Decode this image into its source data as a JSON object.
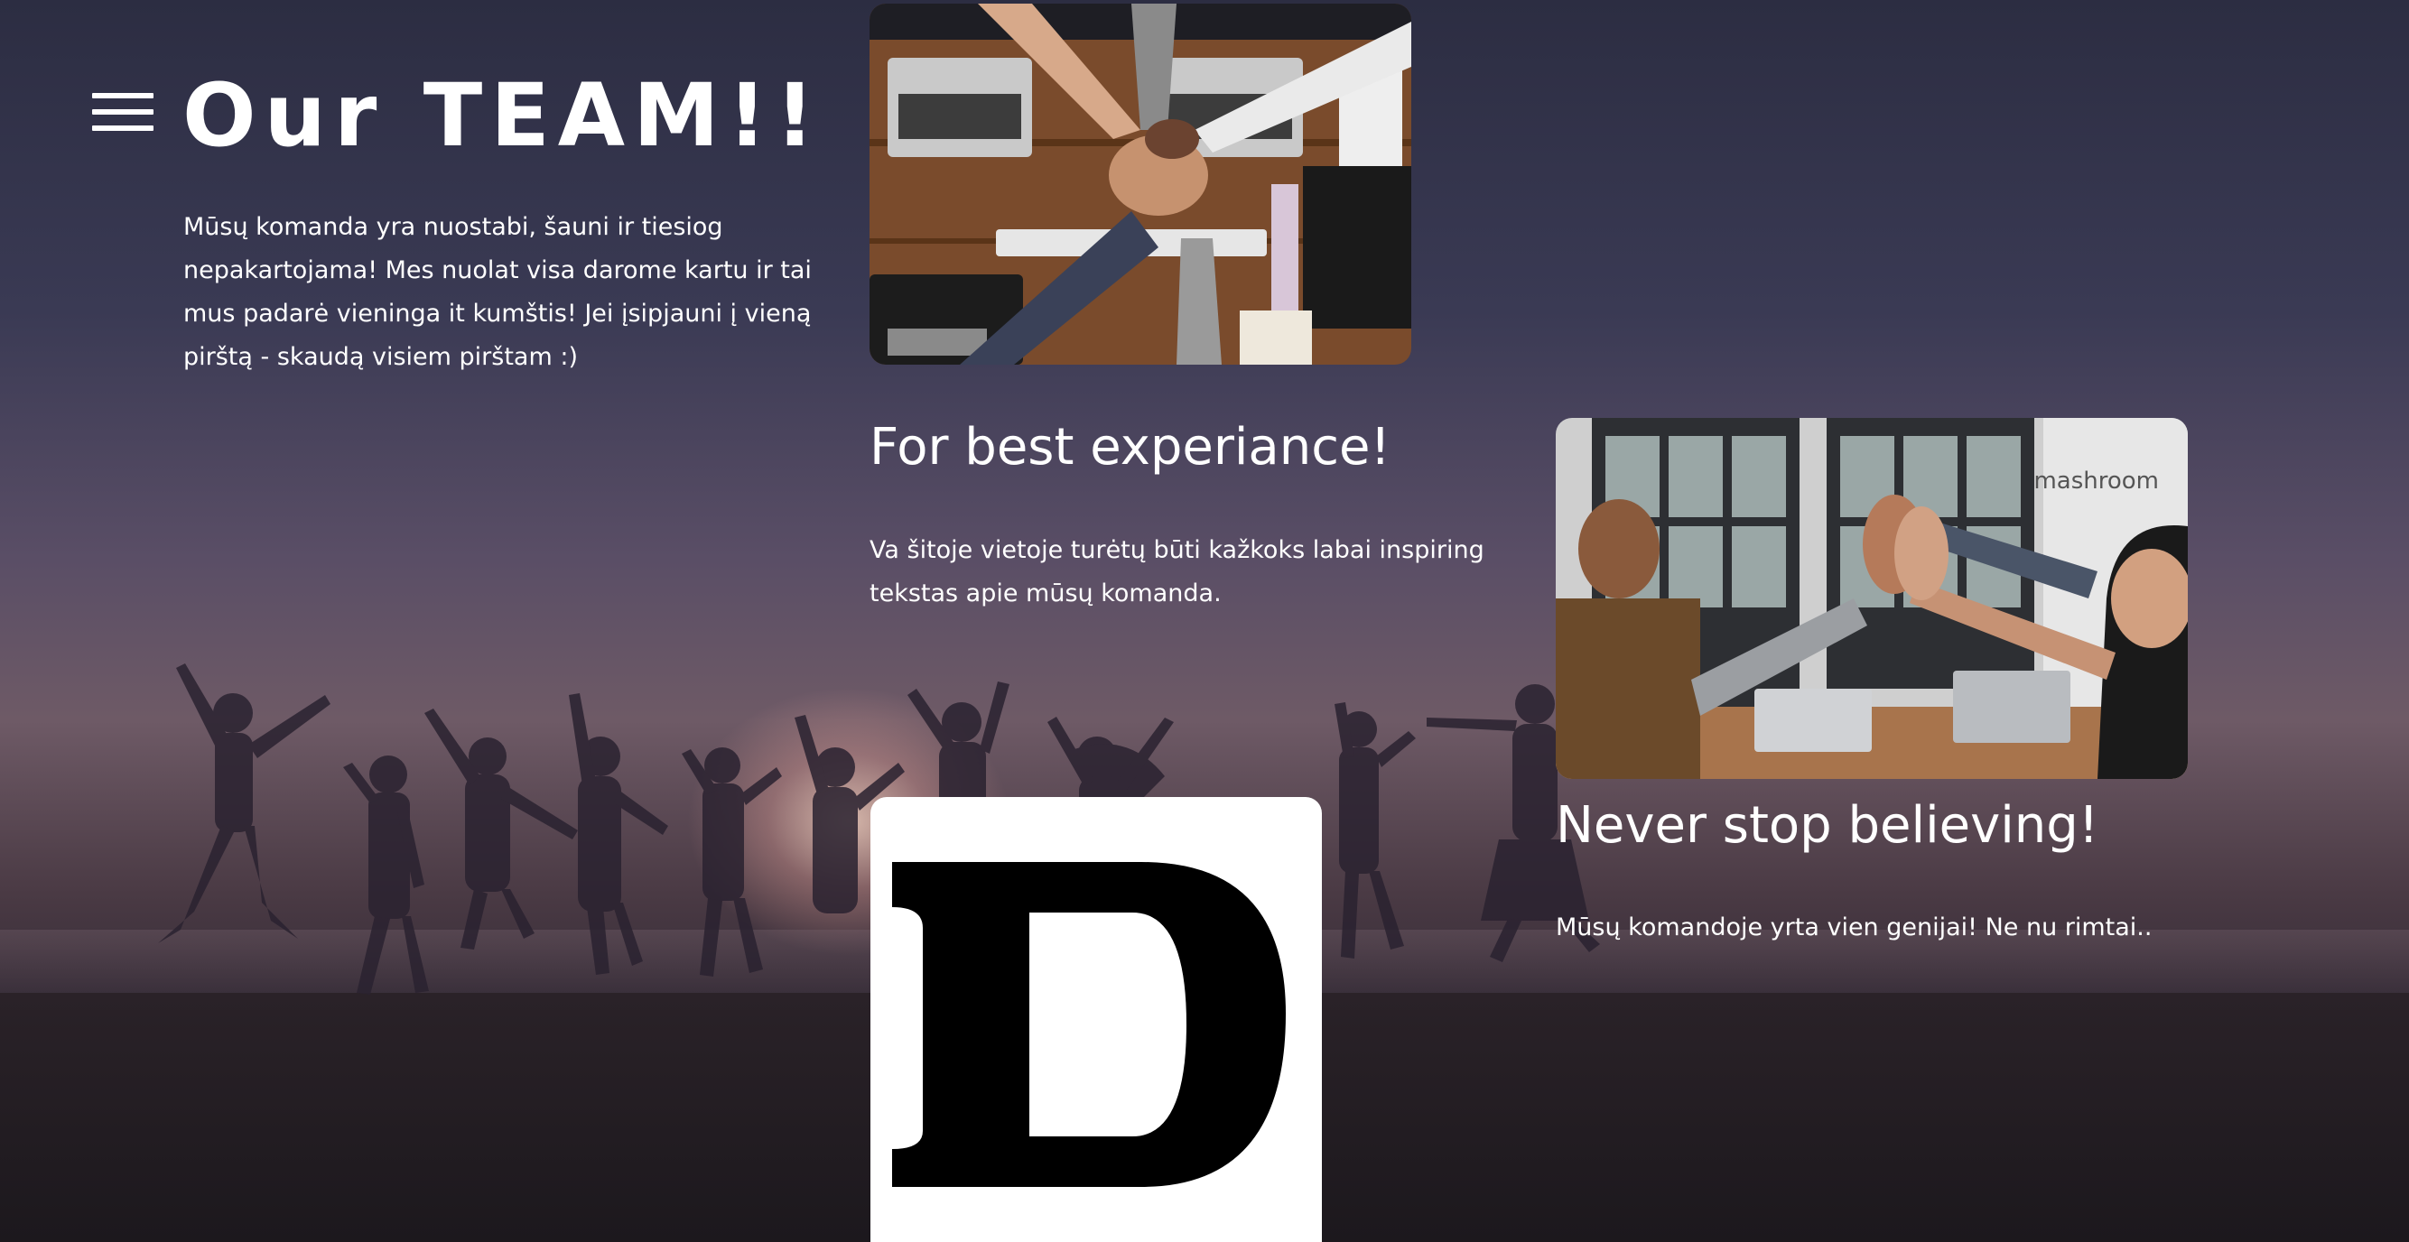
{
  "header": {
    "menu_icon": "hamburger-menu-icon",
    "title": "Our TEAM!!"
  },
  "intro": {
    "text": "Mūsų komanda yra nuostabi, šauni ir tiesiog nepakartojama! Mes nuolat visa darome kartu ir tai mus padarė vieninga it kumštis! Jei įsipjauni į vieną pirštą - skaudą visiem pirštam :)"
  },
  "section_best": {
    "heading": "For best experiance!",
    "text": "Va šitoje vietoje turėtų būti kažkoks labai inspiring tekstas apie mūsų komanda."
  },
  "section_never": {
    "heading": "Never stop believing!",
    "text": "Mūsų komandoje yrta vien genijai! Ne nu rimtai.."
  },
  "images": {
    "teamwork_photo": "team-fist-bump-photo",
    "highfive_photo": "team-high-five-photo",
    "logo": "letter-d-logo",
    "logo_letter": "D",
    "background": "jumping-silhouettes-sunset-photo",
    "highfive_wall_text": "mashroom"
  },
  "colors": {
    "text": "#ffffff",
    "background_top": "#2c2d42",
    "background_bottom": "#1e1a22",
    "logo_background": "#ffffff",
    "logo_letter": "#000000"
  }
}
